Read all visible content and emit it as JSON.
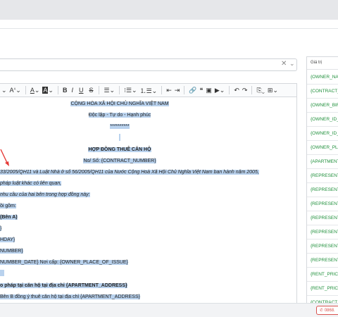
{
  "toolbar": {
    "font_size": "A",
    "text_color": "A",
    "bold": "B",
    "italic": "I",
    "underline": "U",
    "strike": "S"
  },
  "document": {
    "l1": "CỘNG HÒA XÃ HỘI CHỦ NGHĨA VIỆT NAM",
    "l2": "Độc lập - Tự do - Hạnh phúc",
    "l3": "**********",
    "l4": "HỢP ĐỒNG THUÊ CĂN HỘ",
    "l5": "No/ Số: {CONTRACT_NUMBER}",
    "l6": "33/2005/QH11 và Luật Nhà ở số 56/2005/QH11 của Nước Cộng Hoà Xã Hội Chủ Nghĩa Việt Nam ban hành năm 2005,",
    "l7": "pháp luật khác có liên quan,",
    "l8": "nhu cầu của hai bên trong hợp đồng này:",
    "l9": "ồi gồm:",
    "l10": "(Bên A)",
    "l11": "}",
    "l12": "HDAY}",
    "l13": "NUMBER}",
    "l14": "NUMBER_DATE} Nơi cấp: {OWNER_PLACE_OF_ISSUE}",
    "l15": "o pháp tại căn hộ tại địa chỉ {APARTMENT_ADDRESS}",
    "l16": "Bên B đồng ý thuê căn hộ tại địa chỉ {APARTMENT_ADDRESS}"
  },
  "panel": {
    "header": "Giá trị",
    "items": [
      "{OWNER_NA",
      "{CONTRACT_",
      "{OWNER_BIR",
      "{OWNER_ID_",
      "{OWNER_ID_",
      "{OWNER_PLA",
      "{APARTMENT",
      "{REPRESENT",
      "{REPRESENT",
      "{REPRESENT",
      "{REPRESENT",
      "{REPRESENT",
      "{REPRESENT",
      "{REPRESENT",
      "{RENT_PRIC",
      "{RENT_PRIC",
      "{CONTRACT_"
    ]
  },
  "bottom": {
    "phone": "0868."
  },
  "colors": {
    "accent_green": "#1e8f3a",
    "highlight": "#b9d2ee",
    "phone_red": "#d9534f"
  }
}
